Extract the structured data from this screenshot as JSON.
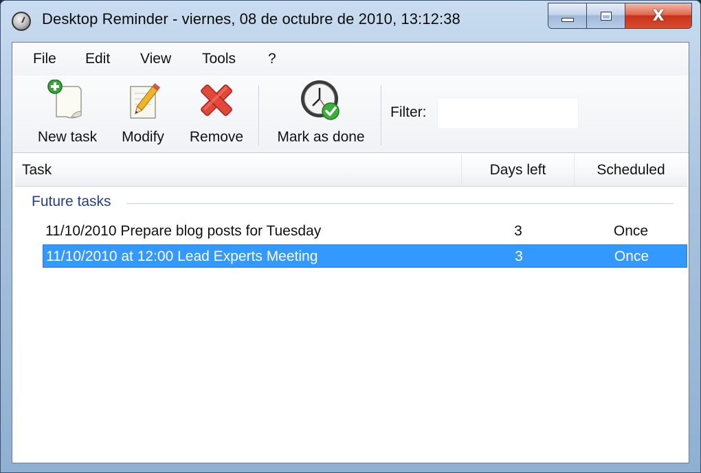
{
  "window": {
    "title": "Desktop Reminder - viernes, 08 de octubre de 2010, 13:12:38",
    "minimize_glyph": "",
    "maximize_glyph": "",
    "close_glyph": "X"
  },
  "menu": [
    "File",
    "Edit",
    "View",
    "Tools",
    "?"
  ],
  "toolbar": {
    "new_task": "New task",
    "modify": "Modify",
    "remove": "Remove",
    "mark_done": "Mark as done",
    "filter_label": "Filter:",
    "filter_value": ""
  },
  "icons": {
    "app": "clock-icon",
    "new_task": "new-document-icon",
    "modify": "pencil-icon",
    "remove": "red-x-icon",
    "mark_done": "clock-check-icon"
  },
  "list": {
    "columns": [
      "Task",
      "Days left",
      "Scheduled"
    ],
    "group": "Future tasks",
    "rows": [
      {
        "task": "11/10/2010 Prepare blog posts for Tuesday",
        "days": "3",
        "scheduled": "Once",
        "selected": false
      },
      {
        "task": "11/10/2010 at 12:00  Lead Experts Meeting",
        "days": "3",
        "scheduled": "Once",
        "selected": true
      }
    ]
  },
  "colors": {
    "selection": "#3399ff",
    "group_text": "#1e3c9c",
    "close_button": "#c7321b"
  }
}
